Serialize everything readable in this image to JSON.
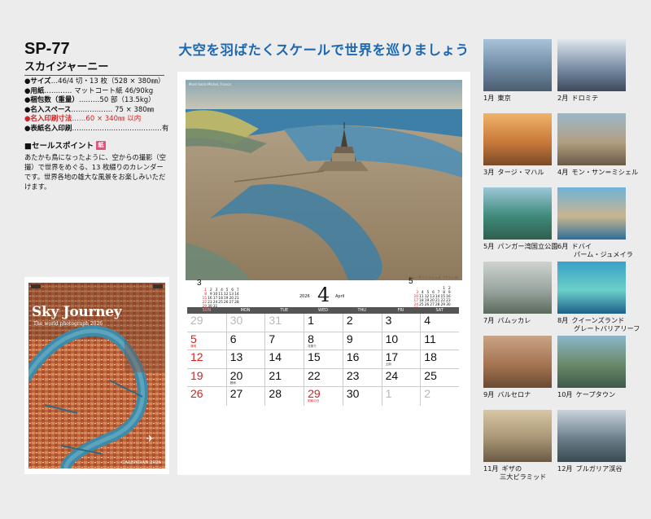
{
  "product": {
    "code": "SP-77",
    "name": "スカイジャーニー",
    "specs": [
      {
        "label": "●サイズ",
        "value": "…46/4 切・13 枚（528 × 380㎜）",
        "red": false
      },
      {
        "label": "●用紙",
        "value": "………… マットコート紙 46/90kg",
        "red": false
      },
      {
        "label": "●梱包数（重量）",
        "value": "………50 部（13.5kg）",
        "red": false
      },
      {
        "label": "●名入スペース",
        "value": "……………… 75 × 380㎜",
        "red": false
      },
      {
        "label": "●名入印刷寸法",
        "value": "……60 × 340㎜ 以内",
        "red": true
      },
      {
        "label": "●表紙名入印刷",
        "value": "…………………………………有",
        "red": false
      }
    ],
    "sales_point_title": "■セールスポイント",
    "sales_point_badge": "紙",
    "sales_point_text": "あたかも鳥になったように、空からの撮影（空撮）で世界をめぐる、13 枚綴りのカレンダーです。世界各地の雄大な風景をお楽しみいただけます。"
  },
  "cover": {
    "title": "Sky Journey",
    "subtitle": "The world photograph 2026",
    "footer": "CALENDAR 2026"
  },
  "headline": "大空を羽ばたくスケールで世界を巡りましょう",
  "calendar": {
    "year": "2026",
    "month": "4",
    "month_en": "April",
    "photo_credit": "Mont-Saint-Michel, France",
    "photo_credit_small": "モン・サン＝ミシェル（フランス）",
    "prev_month": {
      "label": "3",
      "rows": [
        [
          "1",
          "2",
          "3",
          "4",
          "5",
          "6",
          "7"
        ],
        [
          "8",
          "9",
          "10",
          "11",
          "12",
          "13",
          "14"
        ],
        [
          "15",
          "16",
          "17",
          "18",
          "19",
          "20",
          "21"
        ],
        [
          "22",
          "23",
          "24",
          "25",
          "26",
          "27",
          "28"
        ],
        [
          "29",
          "30",
          "31",
          "",
          "",
          "",
          ""
        ]
      ]
    },
    "next_month": {
      "label": "5",
      "rows": [
        [
          "",
          "",
          "",
          "",
          "",
          "1",
          "2"
        ],
        [
          "3",
          "4",
          "5",
          "6",
          "7",
          "8",
          "9"
        ],
        [
          "10",
          "11",
          "12",
          "13",
          "14",
          "15",
          "16"
        ],
        [
          "17",
          "18",
          "19",
          "20",
          "21",
          "22",
          "23"
        ],
        [
          "24",
          "25",
          "26",
          "27",
          "28",
          "29",
          "30"
        ],
        [
          "31",
          "",
          "",
          "",
          "",
          "",
          ""
        ]
      ]
    },
    "weekdays": [
      "SUN",
      "MON",
      "TUE",
      "WED",
      "THU",
      "FRI",
      "SAT"
    ],
    "weeks": [
      [
        {
          "d": "29",
          "s": "grey"
        },
        {
          "d": "30",
          "s": "grey"
        },
        {
          "d": "31",
          "s": "grey"
        },
        {
          "d": "1",
          "s": ""
        },
        {
          "d": "2",
          "s": ""
        },
        {
          "d": "3",
          "s": ""
        },
        {
          "d": "4",
          "s": ""
        }
      ],
      [
        {
          "d": "5",
          "s": "red",
          "h": "清明"
        },
        {
          "d": "6",
          "s": ""
        },
        {
          "d": "7",
          "s": ""
        },
        {
          "d": "8",
          "s": "",
          "h": "花祭り"
        },
        {
          "d": "9",
          "s": ""
        },
        {
          "d": "10",
          "s": ""
        },
        {
          "d": "11",
          "s": ""
        }
      ],
      [
        {
          "d": "12",
          "s": "red"
        },
        {
          "d": "13",
          "s": ""
        },
        {
          "d": "14",
          "s": ""
        },
        {
          "d": "15",
          "s": ""
        },
        {
          "d": "16",
          "s": ""
        },
        {
          "d": "17",
          "s": "",
          "h": "土用"
        },
        {
          "d": "18",
          "s": ""
        }
      ],
      [
        {
          "d": "19",
          "s": "red"
        },
        {
          "d": "20",
          "s": "",
          "h": "穀雨"
        },
        {
          "d": "21",
          "s": ""
        },
        {
          "d": "22",
          "s": ""
        },
        {
          "d": "23",
          "s": ""
        },
        {
          "d": "24",
          "s": ""
        },
        {
          "d": "25",
          "s": ""
        }
      ],
      [
        {
          "d": "26",
          "s": "red"
        },
        {
          "d": "27",
          "s": ""
        },
        {
          "d": "28",
          "s": ""
        },
        {
          "d": "29",
          "s": "red",
          "h": "昭和の日"
        },
        {
          "d": "30",
          "s": ""
        },
        {
          "d": "1",
          "s": "grey"
        },
        {
          "d": "2",
          "s": "grey"
        }
      ]
    ]
  },
  "thumbnails": [
    {
      "month": "1月",
      "name": "東京",
      "name2": ""
    },
    {
      "month": "2月",
      "name": "ドロミテ",
      "name2": ""
    },
    {
      "month": "3月",
      "name": "タージ・マハル",
      "name2": ""
    },
    {
      "month": "4月",
      "name": "モン・サン＝ミシェル",
      "name2": ""
    },
    {
      "month": "5月",
      "name": "パンガー湾国立公園",
      "name2": ""
    },
    {
      "month": "6月",
      "name": "ドバイ",
      "name2": "パーム・ジュメイラ"
    },
    {
      "month": "7月",
      "name": "パムッカレ",
      "name2": ""
    },
    {
      "month": "8月",
      "name": "クイーンズランド",
      "name2": "グレートバリアリーフ"
    },
    {
      "month": "9月",
      "name": "バルセロナ",
      "name2": ""
    },
    {
      "month": "10月",
      "name": "ケープタウン",
      "name2": ""
    },
    {
      "month": "11月",
      "name": "ギザの",
      "name2": "三大ピラミッド"
    },
    {
      "month": "12月",
      "name": "ブルガリア渓谷",
      "name2": ""
    }
  ]
}
